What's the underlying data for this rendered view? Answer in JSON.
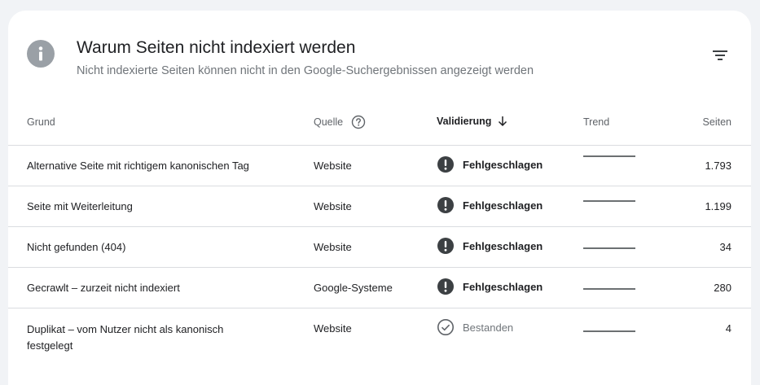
{
  "header": {
    "title": "Warum Seiten nicht indexiert werden",
    "subtitle": "Nicht indexierte Seiten können nicht in den Google-Suchergebnissen angezeigt werden"
  },
  "table": {
    "columns": {
      "reason": "Grund",
      "source": "Quelle",
      "validation": "Validierung",
      "trend": "Trend",
      "pages": "Seiten"
    },
    "rows": [
      {
        "reason": "Alternative Seite mit richtigem kanonischen Tag",
        "source": "Website",
        "validation": "Fehlgeschlagen",
        "validation_status": "failed",
        "pages": "1.793"
      },
      {
        "reason": "Seite mit Weiterleitung",
        "source": "Website",
        "validation": "Fehlgeschlagen",
        "validation_status": "failed",
        "pages": "1.199"
      },
      {
        "reason": "Nicht gefunden (404)",
        "source": "Website",
        "validation": "Fehlgeschlagen",
        "validation_status": "failed",
        "pages": "34"
      },
      {
        "reason": "Gecrawlt – zurzeit nicht indexiert",
        "source": "Google-Systeme",
        "validation": "Fehlgeschlagen",
        "validation_status": "failed",
        "pages": "280"
      },
      {
        "reason": "Duplikat – vom Nutzer nicht als kanonisch festgelegt",
        "source": "Website",
        "validation": "Bestanden",
        "validation_status": "passed",
        "pages": "4"
      }
    ]
  },
  "icons": {
    "info": "info-icon",
    "filter": "filter-icon",
    "help": "help-circle-icon",
    "sort": "arrow-down-icon",
    "failed": "error-icon",
    "passed": "check-circle-icon"
  },
  "colors": {
    "failed_icon": "#3c4043",
    "passed_icon": "#5f6368",
    "trend_line": "#3c4043"
  }
}
